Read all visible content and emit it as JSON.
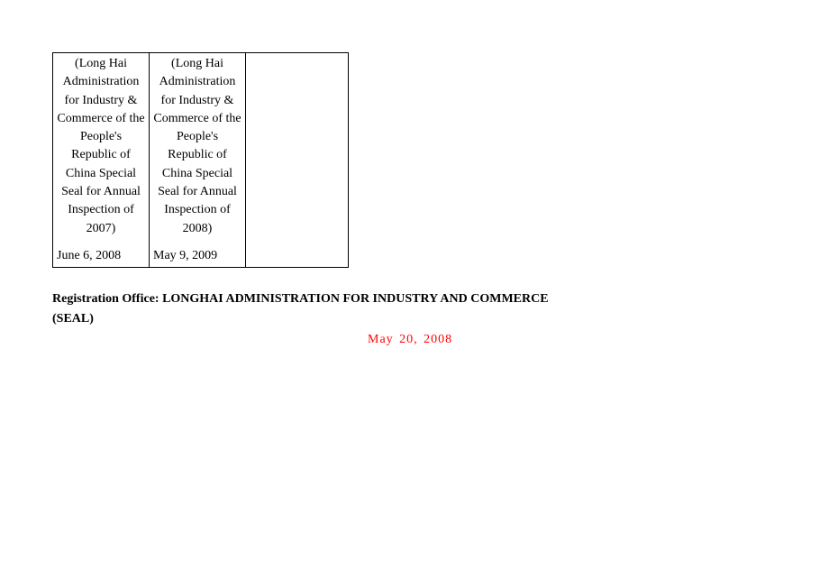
{
  "table": {
    "rows": [
      {
        "col1_seal": "(Long Hai Administration for Industry & Commerce of the People's Republic of China Special Seal for Annual Inspection of 2007)",
        "col1_date": "June 6, 2008",
        "col2_seal": "(Long Hai Administration for Industry & Commerce of the People's Republic of China Special Seal for Annual Inspection of 2008)",
        "col2_date": "May 9, 2009",
        "col3": ""
      }
    ]
  },
  "registration_label": "Registration Office: LONGHAI ADMINISTRATION FOR INDUSTRY AND COMMERCE (SEAL)",
  "issue_date": "May 20, 2008"
}
